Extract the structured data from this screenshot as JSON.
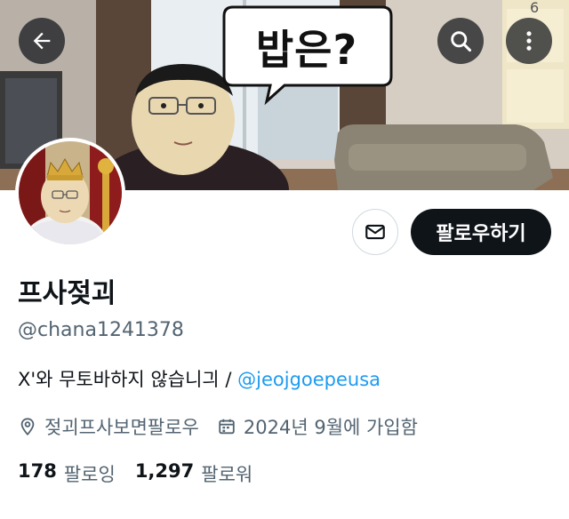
{
  "banner": {
    "speech_text": "밥은?",
    "wall_digit": "6"
  },
  "header": {
    "back_icon": "arrow-left-icon",
    "search_icon": "search-icon",
    "more_icon": "more-vertical-icon"
  },
  "actions": {
    "message_icon": "envelope-icon",
    "follow_label": "팔로우하기"
  },
  "profile": {
    "display_name": "프사젖괴",
    "handle": "@chana1241378",
    "bio_text": "X'와 무토바하지 않습니긔 / ",
    "bio_link": "@jeojgoepeusa",
    "location_icon": "location-pin-icon",
    "location": "젖괴프사보면팔로우",
    "joined_icon": "calendar-icon",
    "joined": "2024년 9월에 가입함"
  },
  "stats": {
    "following_count": "178",
    "following_label": "팔로잉",
    "followers_count": "1,297",
    "followers_label": "팔로워"
  },
  "colors": {
    "text_primary": "#0f1419",
    "text_secondary": "#536471",
    "link": "#1d9bf0",
    "button_dark": "#0f1419"
  }
}
